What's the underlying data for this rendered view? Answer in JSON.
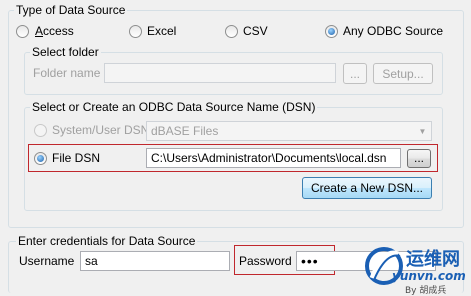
{
  "data_source": {
    "group_label": "Type of Data Source",
    "types": [
      {
        "label": "Access",
        "selected": false
      },
      {
        "label": "Excel",
        "selected": false
      },
      {
        "label": "CSV",
        "selected": false
      },
      {
        "label": "Any ODBC Source",
        "selected": true
      }
    ]
  },
  "select_folder": {
    "group_label": "Select folder",
    "folder_name_label": "Folder name",
    "folder_name_value": "",
    "browse_label": "...",
    "setup_label": "Setup..."
  },
  "dsn": {
    "group_label": "Select or Create an ODBC Data Source Name (DSN)",
    "system_user_label": "System/User DSN",
    "system_user_value": "dBASE Files",
    "file_dsn_label": "File DSN",
    "file_dsn_value": "C:\\Users\\Administrator\\Documents\\local.dsn",
    "browse_label": "...",
    "create_label": "Create a New DSN..."
  },
  "credentials": {
    "group_label": "Enter credentials for Data Source",
    "username_label": "Username",
    "username_value": "sa",
    "password_label": "Password",
    "password_value": "•••"
  },
  "watermark": {
    "title": "运维网",
    "url": "yunvn.com",
    "byline": "By 胡成兵"
  },
  "colors": {
    "highlight_box": "#c0272d",
    "watermark_blue": "#1a5fb4"
  }
}
